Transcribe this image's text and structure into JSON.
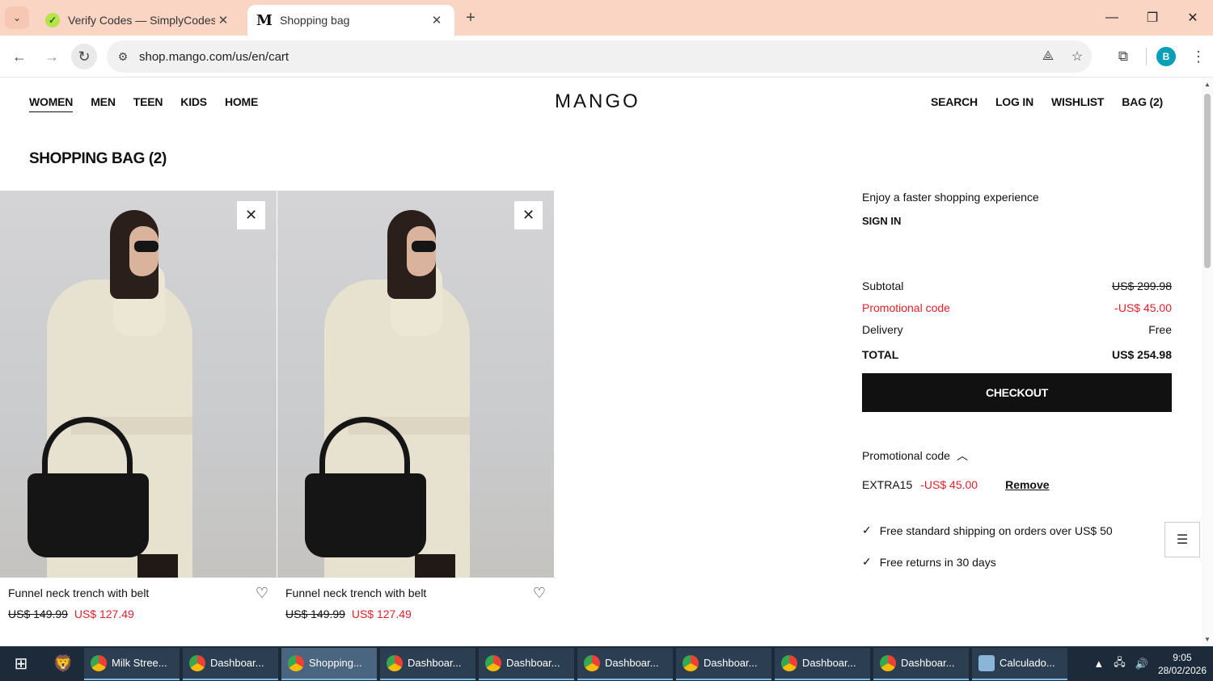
{
  "browser": {
    "tabs": [
      {
        "title": "Verify Codes — SimplyCodes",
        "favicon": "simplycodes-icon"
      },
      {
        "title": "Shopping bag",
        "favicon": "mango-m-icon"
      }
    ],
    "url": "shop.mango.com/us/en/cart",
    "profile_initial": "B"
  },
  "site": {
    "logo": "MANGO",
    "main_nav": [
      "WOMEN",
      "MEN",
      "TEEN",
      "KIDS",
      "HOME"
    ],
    "user_nav": [
      "SEARCH",
      "LOG IN",
      "WISHLIST",
      "BAG (2)"
    ]
  },
  "bag": {
    "title": "SHOPPING BAG (2)",
    "items": [
      {
        "name": "Funnel neck trench with belt",
        "old_price": "US$ 149.99",
        "price": "US$ 127.49"
      },
      {
        "name": "Funnel neck trench with belt",
        "old_price": "US$ 149.99",
        "price": "US$ 127.49"
      }
    ]
  },
  "summary": {
    "hint": "Enjoy a faster shopping experience",
    "sign_in": "SIGN IN",
    "subtotal_label": "Subtotal",
    "subtotal_value": "US$ 299.98",
    "promo_label": "Promotional code",
    "promo_value": "-US$ 45.00",
    "delivery_label": "Delivery",
    "delivery_value": "Free",
    "total_label": "TOTAL",
    "total_value": "US$ 254.98",
    "checkout": "CHECKOUT",
    "promo_toggle": "Promotional code",
    "applied_code": "EXTRA15",
    "applied_discount": "-US$ 45.00",
    "remove": "Remove",
    "benefits": [
      "Free standard shipping on orders over US$ 50",
      "Free returns in 30 days"
    ]
  },
  "colors": {
    "accent_red": "#e0212a",
    "checkout_bg": "#111111",
    "tabstrip": "#fad5c4"
  },
  "taskbar": {
    "tasks": [
      "Milk Stree...",
      "Dashboar...",
      "Shopping...",
      "Dashboar...",
      "Dashboar...",
      "Dashboar...",
      "Dashboar...",
      "Dashboar...",
      "Dashboar...",
      "Calculado..."
    ],
    "time": "9:05",
    "date": "28/02/2026"
  }
}
